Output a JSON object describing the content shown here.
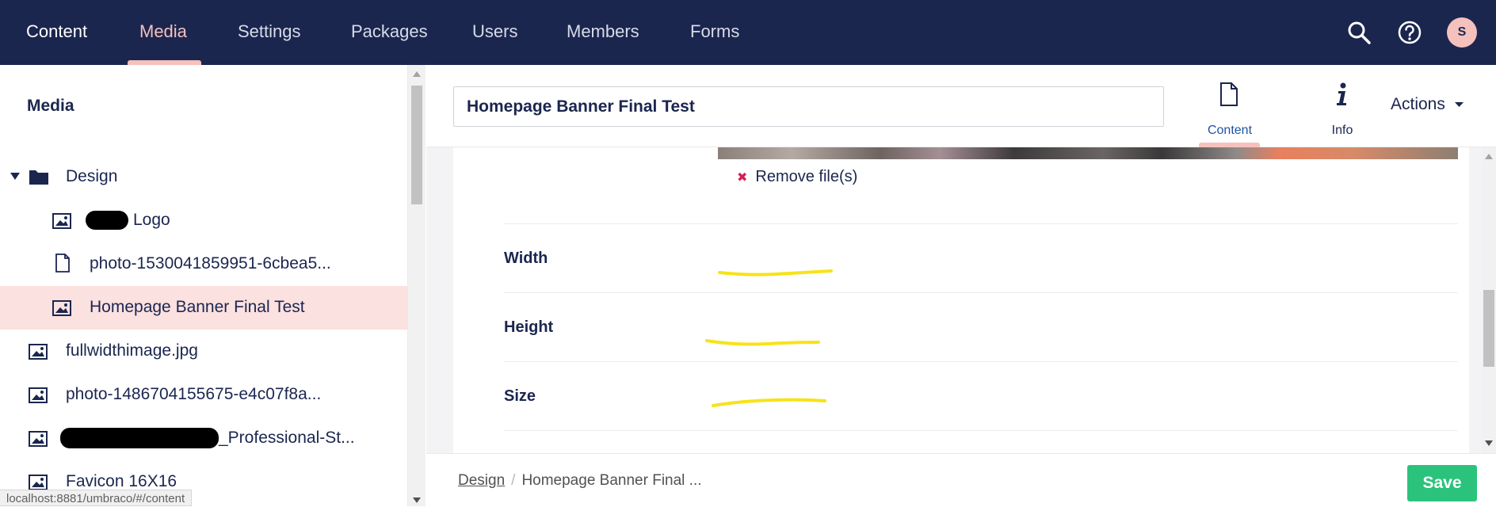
{
  "nav": {
    "items": [
      "Content",
      "Media",
      "Settings",
      "Packages",
      "Users",
      "Members",
      "Forms"
    ],
    "active_index": 1,
    "avatar_initial": "S"
  },
  "tree": {
    "title": "Media",
    "items": [
      {
        "label": "Design",
        "icon": "folder-icon",
        "expanded": true
      },
      {
        "label": "Logo",
        "icon": "image-icon",
        "redacted_prefix": true
      },
      {
        "label": "photo-1530041859951-6cbea5...",
        "icon": "file-icon"
      },
      {
        "label": "Homepage Banner Final Test",
        "icon": "image-icon",
        "selected": true
      },
      {
        "label": "fullwidthimage.jpg",
        "icon": "image-icon"
      },
      {
        "label": "photo-1486704155675-e4c07f8a...",
        "icon": "image-icon"
      },
      {
        "label": "_Professional-St...",
        "icon": "image-icon",
        "redacted_prefix": true
      },
      {
        "label": "Favicon 16X16",
        "icon": "image-icon"
      }
    ]
  },
  "status_url": "localhost:8881/umbraco/#/content",
  "editor": {
    "name_value": "Homepage Banner Final Test",
    "tabs": [
      {
        "label": "Content",
        "icon": "document-icon",
        "active": true
      },
      {
        "label": "Info",
        "icon": "info-icon"
      }
    ],
    "actions_label": "Actions",
    "remove_label": "Remove file(s)",
    "properties": [
      {
        "label": "Width"
      },
      {
        "label": "Height"
      },
      {
        "label": "Size"
      }
    ]
  },
  "footer": {
    "breadcrumb": [
      "Design",
      "Homepage Banner Final ..."
    ],
    "save_label": "Save"
  },
  "colors": {
    "nav_bg": "#1b264f",
    "accent_pink": "#f5c1bc",
    "selected_row": "#fbe1e0",
    "save_green": "#2bc37c",
    "highlight_yellow": "#f7e318",
    "remove_red": "#d42054"
  }
}
